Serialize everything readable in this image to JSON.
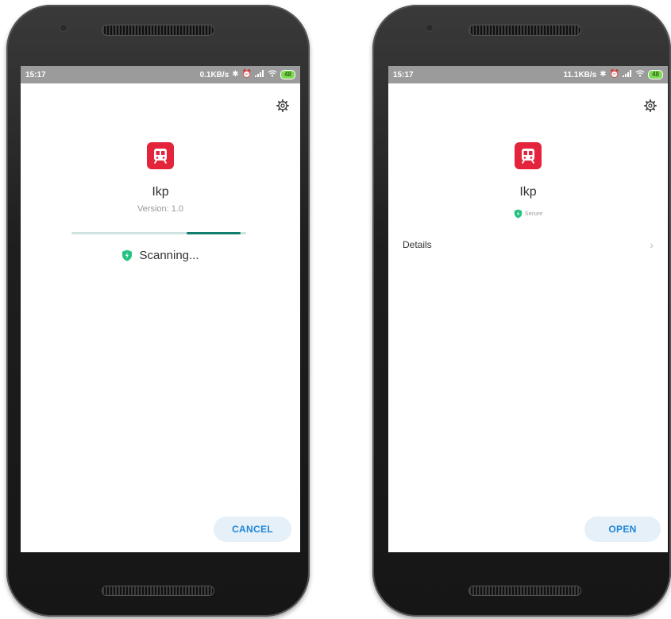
{
  "left_screen": {
    "status": {
      "time": "15:17",
      "speed": "0.1KB/s",
      "battery": "48"
    },
    "app": {
      "name": "Ikp",
      "version": "Version: 1.0"
    },
    "scan": {
      "progress_start": 0.66,
      "progress_end": 0.97,
      "status_text": "Scanning..."
    },
    "cancel_label": "CANCEL"
  },
  "right_screen": {
    "status": {
      "time": "15:17",
      "speed": "11.1KB/s",
      "battery": "48"
    },
    "app": {
      "name": "Ikp",
      "secure_label": "Secure"
    },
    "details_label": "Details",
    "chevron": "›",
    "open_label": "OPEN"
  },
  "icons": {
    "settings": "gear-icon",
    "app": "train-icon",
    "shield": "shield-icon",
    "bluetooth": "bluetooth-icon",
    "alarm": "alarm-icon",
    "signal": "signal-icon",
    "wifi": "wifi-icon",
    "battery": "battery-icon"
  },
  "colors": {
    "app_icon": "#e3243b",
    "progress_track": "#cfe4e2",
    "progress_fill": "#127d6e",
    "shield": "#26c281",
    "button_bg": "#e6f0f8",
    "button_text": "#1d86d8",
    "status_bar": "#9b9b9b"
  }
}
